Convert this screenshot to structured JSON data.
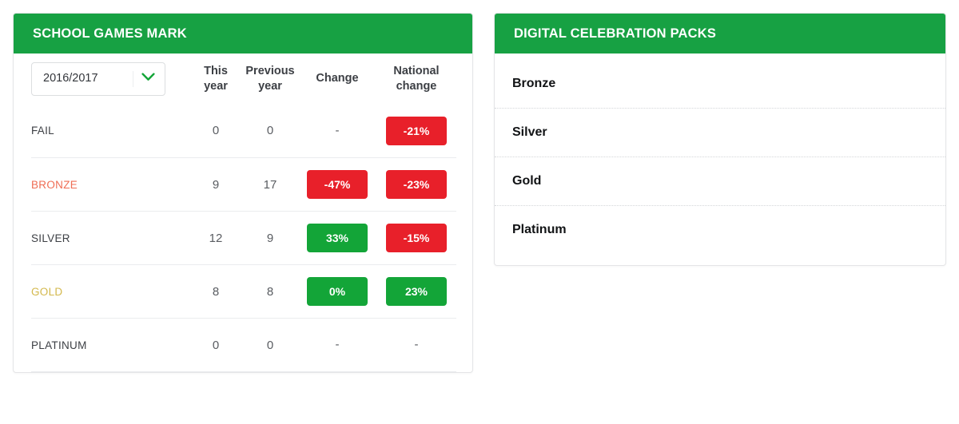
{
  "school_games_mark": {
    "title": "SCHOOL GAMES MARK",
    "year_select": {
      "value": "2016/2017",
      "icon": "chevron-down-icon"
    },
    "columns": [
      {
        "key": "label",
        "label": ""
      },
      {
        "key": "this",
        "label": "This year"
      },
      {
        "key": "prev",
        "label": "Previous year"
      },
      {
        "key": "change",
        "label": "Change"
      },
      {
        "key": "natl",
        "label": "National change"
      }
    ],
    "column_labels": {
      "this_year_line1": "This",
      "this_year_line2": "year",
      "previous_year_line1": "Previous",
      "previous_year_line2": "year",
      "change": "Change",
      "national_change_line1": "National",
      "national_change_line2": "change"
    },
    "rows": [
      {
        "label": "FAIL",
        "this_year": "0",
        "previous_year": "0",
        "change": "-",
        "change_kind": "none",
        "national_change": "-21%",
        "national_change_kind": "neg"
      },
      {
        "label": "BRONZE",
        "this_year": "9",
        "previous_year": "17",
        "change": "-47%",
        "change_kind": "neg",
        "national_change": "-23%",
        "national_change_kind": "neg"
      },
      {
        "label": "SILVER",
        "this_year": "12",
        "previous_year": "9",
        "change": "33%",
        "change_kind": "pos",
        "national_change": "-15%",
        "national_change_kind": "neg"
      },
      {
        "label": "GOLD",
        "this_year": "8",
        "previous_year": "8",
        "change": "0%",
        "change_kind": "pos",
        "national_change": "23%",
        "national_change_kind": "pos"
      },
      {
        "label": "PLATINUM",
        "this_year": "0",
        "previous_year": "0",
        "change": "-",
        "change_kind": "none",
        "national_change": "-",
        "national_change_kind": "none"
      }
    ]
  },
  "digital_celebration_packs": {
    "title": "DIGITAL CELEBRATION PACKS",
    "items": [
      {
        "label": "Bronze"
      },
      {
        "label": "Silver"
      },
      {
        "label": "Gold"
      },
      {
        "label": "Platinum"
      }
    ]
  },
  "colors": {
    "header_green": "#17a143",
    "badge_green": "#13a538",
    "badge_red": "#e8202a",
    "bronze_text": "#ef6d54",
    "gold_text": "#d3b84c",
    "body_text": "#3c3f44"
  }
}
